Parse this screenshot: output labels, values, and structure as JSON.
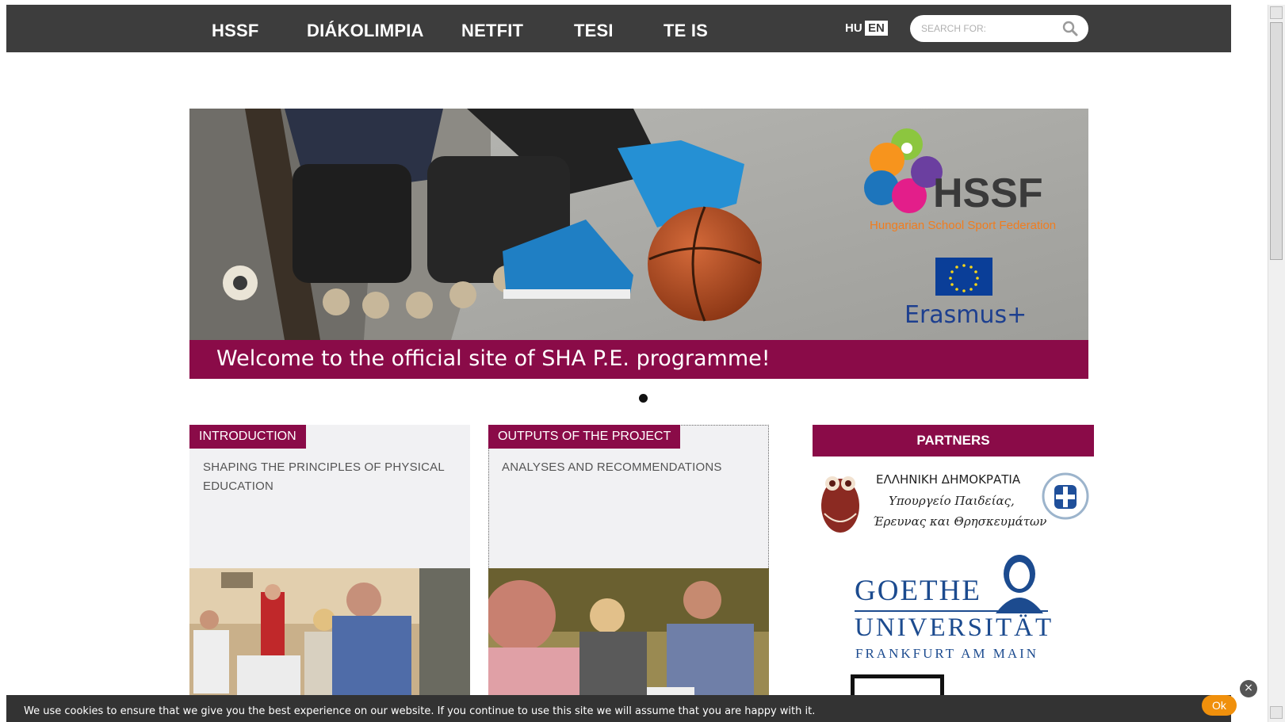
{
  "nav": {
    "items": [
      {
        "label": "HSSF"
      },
      {
        "label": "DIÁKOLIMPIA"
      },
      {
        "label": "NETFIT"
      },
      {
        "label": "TESI"
      },
      {
        "label": "TE IS"
      }
    ],
    "lang_hu": "HU",
    "lang_en": "EN",
    "search_placeholder": "SEARCH FOR:"
  },
  "hero": {
    "logo_title": "HSSF",
    "logo_subtitle": "Hungarian School Sport Federation",
    "erasmus": "Erasmus+",
    "welcome": "Welcome to the official site of SHA P.E. programme!"
  },
  "cards": [
    {
      "label": "INTRODUCTION",
      "text": "SHAPING THE PRINCIPLES OF PHYSICAL EDUCATION"
    },
    {
      "label": "OUTPUTS OF THE PROJECT",
      "text": "ANALYSES AND RECOMMENDATIONS"
    }
  ],
  "partners": {
    "heading": "PARTNERS",
    "greek_line1": "ΕΛΛΗΝΙΚΗ ΔΗΜΟΚΡΑΤΙΑ",
    "greek_line2": "Υπουργείο Παιδείας,",
    "greek_line3": "Έρευνας και Θρησκευμάτων",
    "goethe_line1": "GOETHE",
    "goethe_line2": "UNIVERSITÄT",
    "goethe_line3": "FRANKFURT AM MAIN"
  },
  "cookie": {
    "message": "We use cookies to ensure that we give you the best experience on our website. If you continue to use this site we will assume that you are happy with it.",
    "ok_label": "Ok",
    "close_label": "×"
  },
  "colors": {
    "nav_bg": "#3d3d3d",
    "brand": "#8a0b48",
    "card_bg": "#f1f1f3",
    "cookie_bg": "#333333",
    "ok_button": "#f0900c",
    "goethe_blue": "#1c4b8f"
  }
}
